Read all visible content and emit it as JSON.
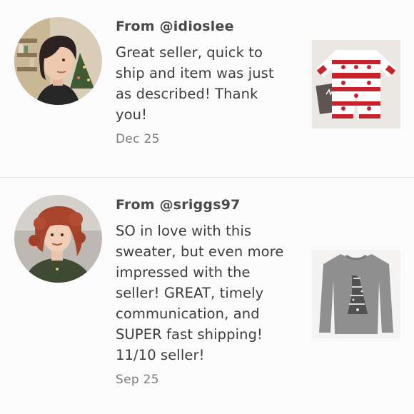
{
  "reviews": [
    {
      "from": "From @idioslee",
      "lines": [
        "Great seller, quick to",
        "ship and item was just",
        "as described! Thank",
        "you!"
      ],
      "date": "Dec 25",
      "avatar_icon": "reviewer-photo",
      "thumb_icon": "reindeer-pajama-photo"
    },
    {
      "from": "From @sriggs97",
      "lines": [
        "SO in love with this",
        "sweater, but even more",
        "impressed with the",
        "seller! GREAT, timely",
        "communication, and",
        "SUPER fast shipping!",
        "11/10 seller!"
      ],
      "date": "Sep 25",
      "avatar_icon": "reviewer-photo",
      "thumb_icon": "gray-sweater-photo"
    }
  ],
  "colors": {
    "background": "#fcfbfc",
    "divider": "#e6e3e6",
    "username": "#4a4a4a",
    "body_text": "#3d3d3d",
    "date": "#7b7b7b"
  }
}
